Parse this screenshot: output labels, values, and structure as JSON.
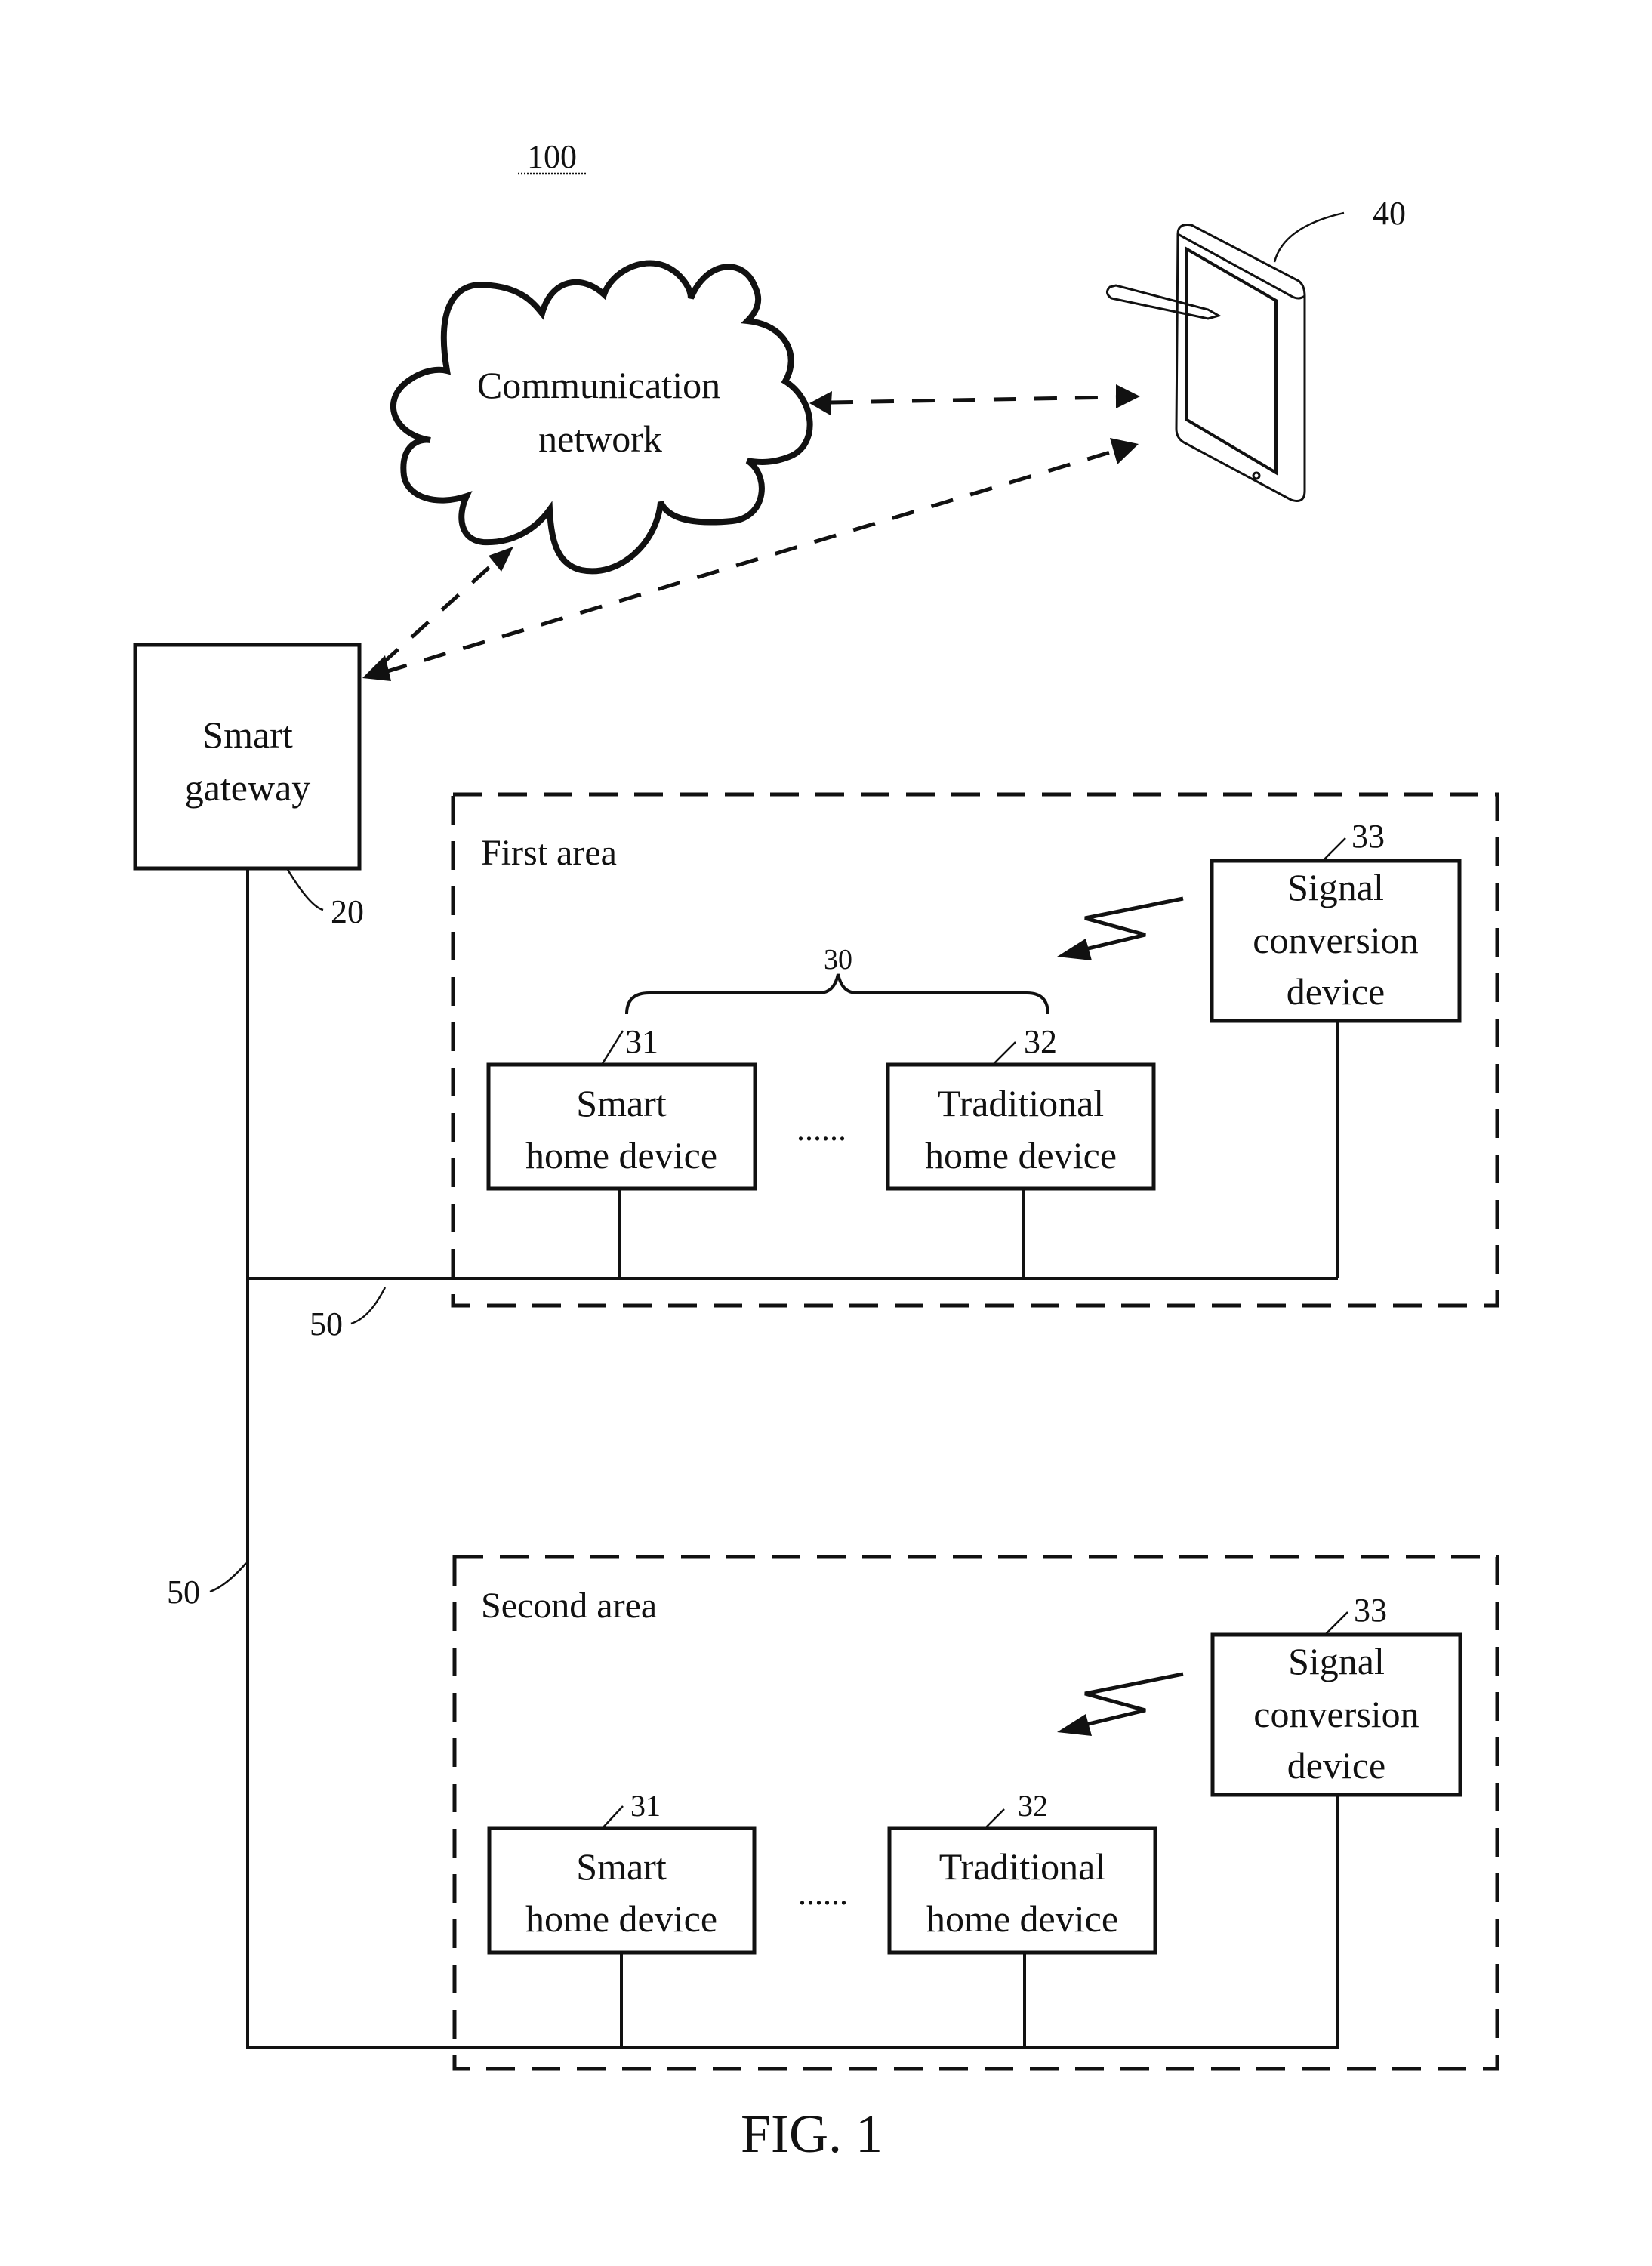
{
  "figure": {
    "reference": "100",
    "caption": "FIG. 1"
  },
  "network": {
    "label_line1": "Communication",
    "label_line2": "network"
  },
  "terminal": {
    "ref": "40",
    "icon": "smartphone-with-stylus-icon"
  },
  "gateway": {
    "label_line1": "Smart",
    "label_line2": "gateway",
    "ref": "20"
  },
  "bus": {
    "ref_horizontal": "50",
    "ref_vertical": "50"
  },
  "areas": [
    {
      "title": "First area",
      "group_ref": "30",
      "smart_device": {
        "line1": "Smart",
        "line2": "home device",
        "ref": "31"
      },
      "ellipsis": "......",
      "traditional_device": {
        "line1": "Traditional",
        "line2": "home device",
        "ref": "32"
      },
      "converter": {
        "line1": "Signal",
        "line2": "conversion",
        "line3": "device",
        "ref": "33"
      }
    },
    {
      "title": "Second area",
      "smart_device": {
        "line1": "Smart",
        "line2": "home device",
        "ref": "31"
      },
      "ellipsis": "......",
      "traditional_device": {
        "line1": "Traditional",
        "line2": "home device",
        "ref": "32"
      },
      "converter": {
        "line1": "Signal",
        "line2": "conversion",
        "line3": "device",
        "ref": "33"
      }
    }
  ]
}
